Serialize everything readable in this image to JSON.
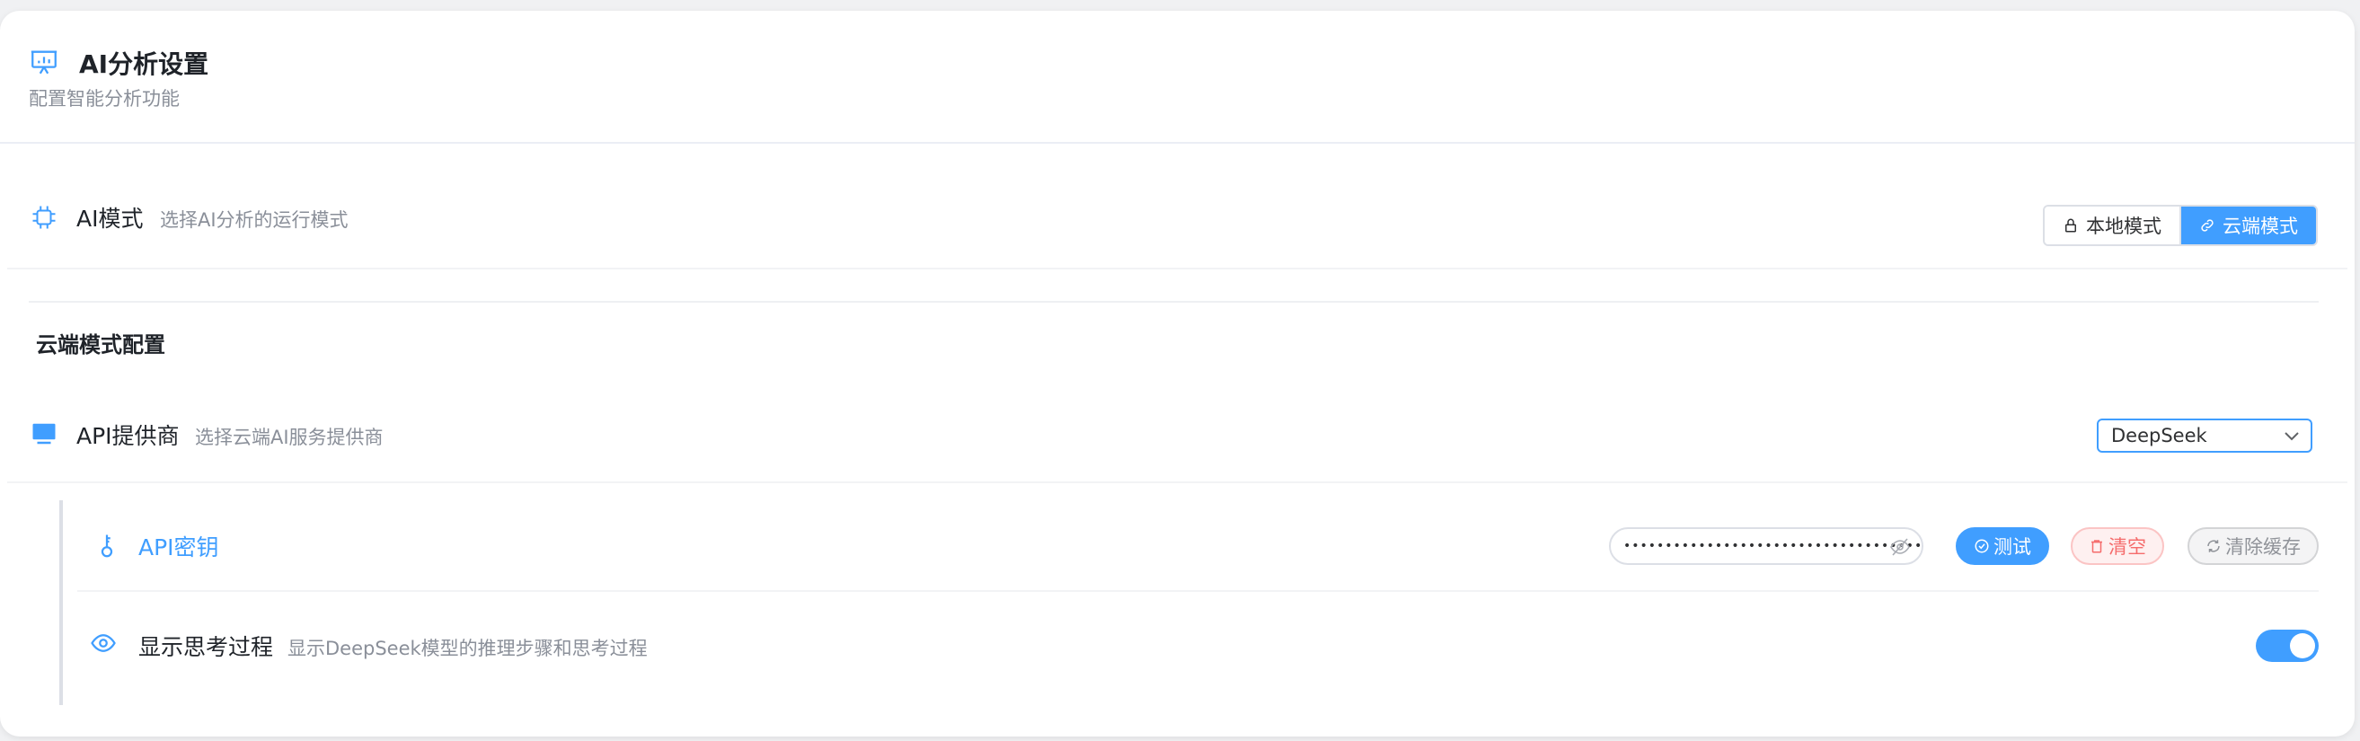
{
  "header": {
    "icon": "presentation-chart-icon",
    "title": "AI分析设置",
    "subtitle": "配置智能分析功能"
  },
  "ai_mode": {
    "icon": "cpu-chip-icon",
    "label": "AI模式",
    "description": "选择AI分析的运行模式",
    "options": [
      {
        "icon": "lock-icon",
        "label": "本地模式",
        "active": false
      },
      {
        "icon": "link-icon",
        "label": "云端模式",
        "active": true
      }
    ]
  },
  "cloud_config": {
    "section_title": "云端模式配置",
    "provider": {
      "icon": "monitor-icon",
      "label": "API提供商",
      "description": "选择云端AI服务提供商",
      "selected": "DeepSeek"
    },
    "api_key": {
      "icon": "key-icon",
      "label": "API密钥",
      "value": "••••••••••••••••••••••••••••••••••••",
      "eye_icon": "eye-off-icon",
      "buttons": {
        "test": "测试",
        "clear": "清空",
        "clear_cache": "清除缓存"
      }
    },
    "show_thinking": {
      "icon": "eye-icon",
      "label": "显示思考过程",
      "description": "显示DeepSeek模型的推理步骤和思考过程",
      "enabled": true
    }
  },
  "colors": {
    "accent": "#409eff",
    "danger": "#f56c6c",
    "muted": "#909399"
  }
}
